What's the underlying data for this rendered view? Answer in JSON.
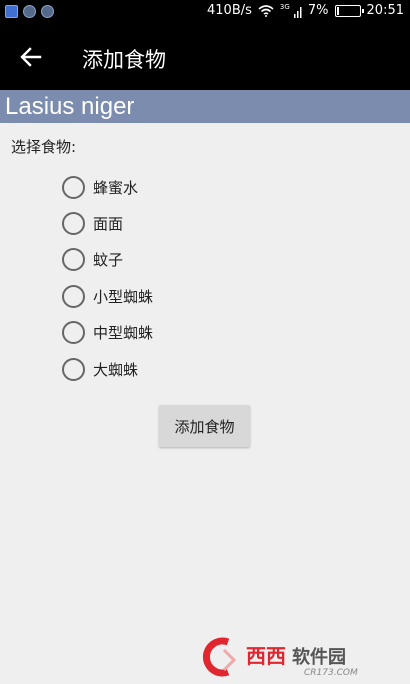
{
  "status_bar": {
    "net_speed": "410B/s",
    "signal_tag": "3G",
    "battery_percent": "7%",
    "battery_level": 0.07,
    "time": "20:51"
  },
  "app_bar": {
    "back_icon": "arrow-left-icon",
    "title": "添加食物"
  },
  "species_header": "Lasius niger",
  "food_form": {
    "prompt": "选择食物:",
    "options": [
      {
        "label": "蜂蜜水",
        "selected": false
      },
      {
        "label": "面面",
        "selected": false
      },
      {
        "label": "蚊子",
        "selected": false
      },
      {
        "label": "小型蜘蛛",
        "selected": false
      },
      {
        "label": "中型蜘蛛",
        "selected": false
      },
      {
        "label": "大蜘蛛",
        "selected": false
      }
    ],
    "submit_label": "添加食物"
  },
  "watermark": {
    "brand": "西西软件园",
    "domain": "CR173.COM"
  },
  "colors": {
    "header_band": "#7b8cae",
    "app_bar": "#000000",
    "background": "#efefef",
    "watermark_red": "#e0262e"
  }
}
